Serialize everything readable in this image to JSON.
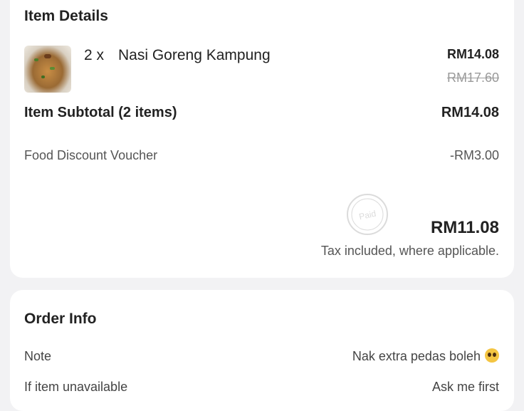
{
  "item_details": {
    "title": "Item Details",
    "items": [
      {
        "quantity": "2 x",
        "name": "Nasi Goreng Kampung",
        "price": "RM14.08",
        "original_price": "RM17.60",
        "image": "nasi-goreng-thumbnail"
      }
    ],
    "subtotal_label": "Item Subtotal (2 items)",
    "subtotal_value": "RM14.08",
    "discount_label": "Food Discount Voucher",
    "discount_value": "-RM3.00",
    "stamp_text": "Paid",
    "total": "RM11.08",
    "tax_note": "Tax included, where applicable."
  },
  "order_info": {
    "title": "Order Info",
    "note_label": "Note",
    "note_value": "Nak extra pedas boleh",
    "note_emoji": "pleading-face-emoji",
    "unavailable_label": "If item unavailable",
    "unavailable_value": "Ask me first"
  },
  "colors": {
    "background": "#f2f2f4",
    "card": "#ffffff",
    "text": "#222222",
    "muted": "#555555",
    "strike": "#9a9a9a"
  }
}
